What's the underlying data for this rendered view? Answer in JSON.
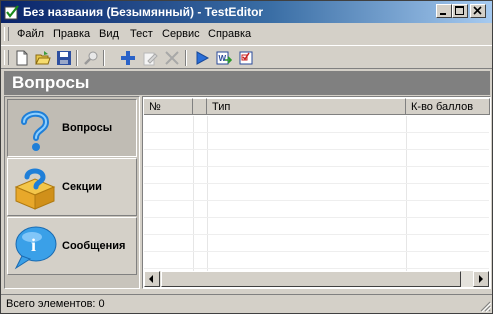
{
  "window": {
    "title": "Без названия (Безымянный) - TestEditor",
    "controls": [
      "minimize",
      "maximize",
      "close"
    ]
  },
  "menu": {
    "items": [
      {
        "label": "Файл"
      },
      {
        "label": "Правка"
      },
      {
        "label": "Вид"
      },
      {
        "label": "Тест"
      },
      {
        "label": "Сервис"
      },
      {
        "label": "Справка"
      }
    ]
  },
  "toolbar": {
    "buttons": [
      {
        "icon": "new-document-icon"
      },
      {
        "icon": "open-folder-icon"
      },
      {
        "icon": "save-icon"
      },
      {
        "icon": "find-icon"
      },
      {
        "icon": "add-icon"
      },
      {
        "icon": "edit-icon"
      },
      {
        "icon": "delete-icon"
      },
      {
        "icon": "run-icon"
      },
      {
        "icon": "export-word-icon"
      },
      {
        "icon": "checklist-icon"
      }
    ]
  },
  "section_header": "Вопросы",
  "nav": {
    "items": [
      {
        "label": "Вопросы",
        "icon": "question-mark-icon",
        "active": true
      },
      {
        "label": "Секции",
        "icon": "box-question-icon",
        "active": false
      },
      {
        "label": "Сообщения",
        "icon": "info-bubble-icon",
        "active": false
      }
    ]
  },
  "grid": {
    "columns": [
      "№",
      "",
      "Тип",
      "К-во баллов"
    ],
    "rows": []
  },
  "status": {
    "text": "Всего элементов: 0"
  },
  "colors": {
    "titlebar_start": "#0a246a",
    "titlebar_end": "#a6caf0",
    "face": "#d4d0c8",
    "header_bg": "#808080"
  }
}
